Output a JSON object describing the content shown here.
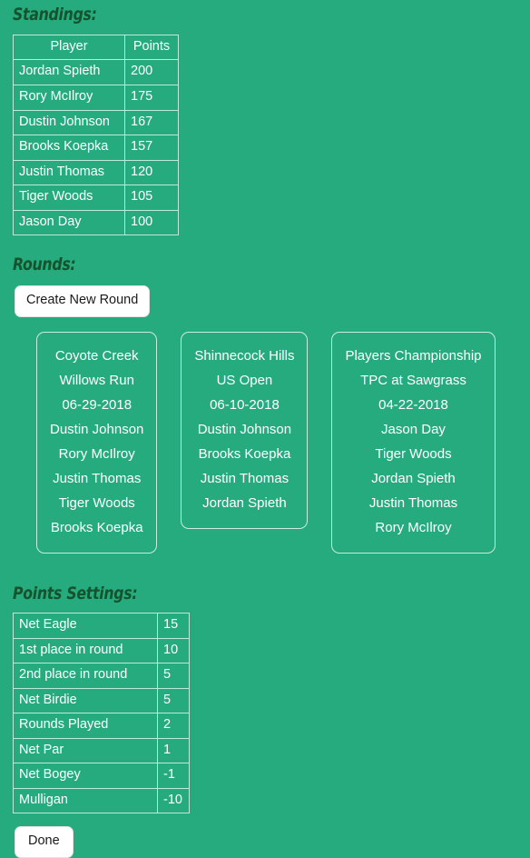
{
  "theme": {
    "background": "#26ab7f",
    "heading_color": "#14532d",
    "text_color": "#ffffff",
    "border_color": "#bfe9d8",
    "button_background": "#ffffff",
    "button_text": "#1a1a1a"
  },
  "standings": {
    "heading": "Standings:",
    "columns": [
      "Player",
      "Points"
    ],
    "rows": [
      {
        "player": "Jordan Spieth",
        "points": "200"
      },
      {
        "player": "Rory McIlroy",
        "points": "175"
      },
      {
        "player": "Dustin Johnson",
        "points": "167"
      },
      {
        "player": "Brooks Koepka",
        "points": "157"
      },
      {
        "player": "Justin Thomas",
        "points": "120"
      },
      {
        "player": "Tiger Woods",
        "points": "105"
      },
      {
        "player": "Jason Day",
        "points": "100"
      }
    ]
  },
  "rounds": {
    "heading": "Rounds:",
    "create_button_label": "Create New Round",
    "cards": [
      {
        "name": "Coyote Creek",
        "course": "Willows Run",
        "date": "06-29-2018",
        "players": [
          "Dustin Johnson",
          "Rory McIlroy",
          "Justin Thomas",
          "Tiger Woods",
          "Brooks Koepka"
        ]
      },
      {
        "name": "Shinnecock Hills",
        "course": "US Open",
        "date": "06-10-2018",
        "players": [
          "Dustin Johnson",
          "Brooks Koepka",
          "Justin Thomas",
          "Jordan Spieth"
        ]
      },
      {
        "name": "Players Championship",
        "course": "TPC at Sawgrass",
        "date": "04-22-2018",
        "players": [
          "Jason Day",
          "Tiger Woods",
          "Jordan Spieth",
          "Justin Thomas",
          "Rory McIlroy"
        ]
      }
    ]
  },
  "points_settings": {
    "heading": "Points Settings:",
    "rows": [
      {
        "label": "Net Eagle",
        "value": "15"
      },
      {
        "label": "1st place in round",
        "value": "10"
      },
      {
        "label": "2nd place in round",
        "value": "5"
      },
      {
        "label": "Net Birdie",
        "value": "5"
      },
      {
        "label": "Rounds Played",
        "value": "2"
      },
      {
        "label": "Net Par",
        "value": "1"
      },
      {
        "label": "Net Bogey",
        "value": "-1"
      },
      {
        "label": "Mulligan",
        "value": "-10"
      }
    ]
  },
  "footer": {
    "done_button_label": "Done"
  }
}
